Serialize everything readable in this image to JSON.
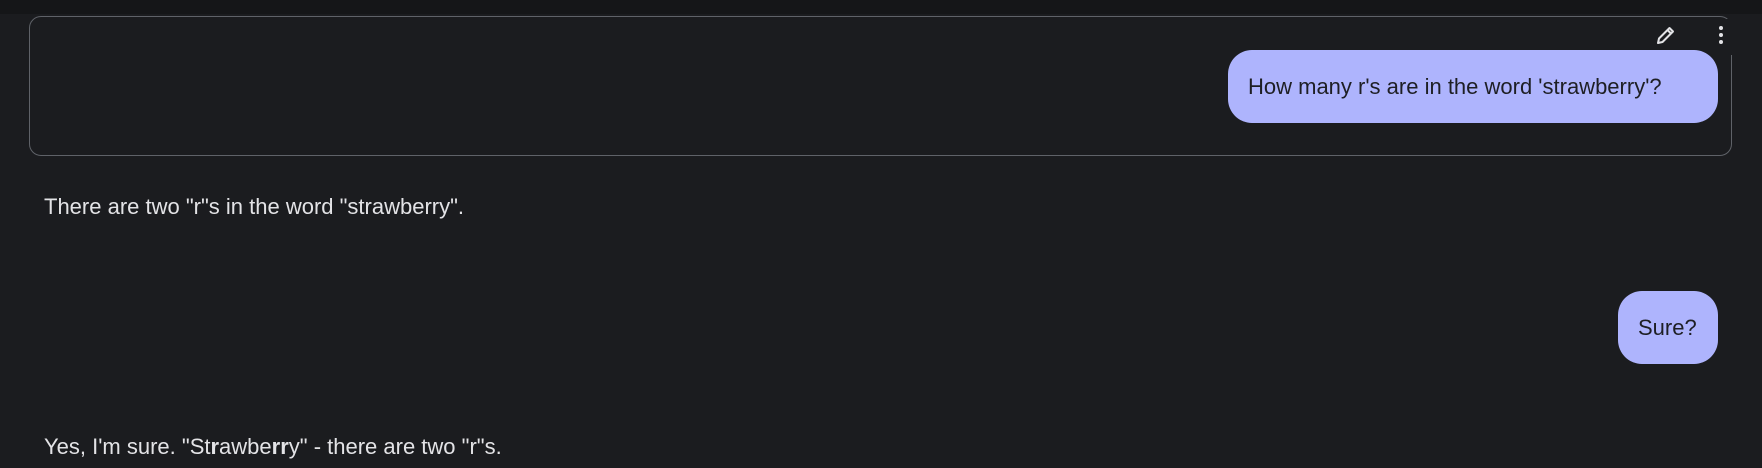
{
  "conversation": {
    "turn_1": {
      "user_message": "How many r's are in the word 'strawberry'?",
      "model_reply": "There are two \"r\"s in the word \"strawberry\"."
    },
    "turn_2": {
      "user_message": "Sure?",
      "model_reply_parts": {
        "p1": "Yes, I'm sure. \"St",
        "p2": "r",
        "p3": "awbe",
        "p4": "rr",
        "p5": "y\" - there are two \"r\"s."
      }
    }
  },
  "icons": {
    "edit": "pencil-icon",
    "more": "more-vert-icon"
  },
  "colors": {
    "background": "#1b1c1f",
    "user_bubble": "#aeb4fd",
    "model_text": "#e3e3e6",
    "frame_border": "#5f6268"
  }
}
